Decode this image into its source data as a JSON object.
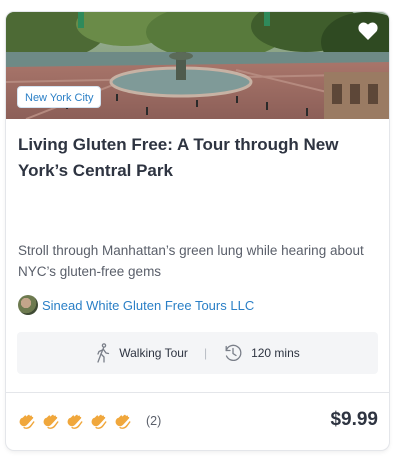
{
  "card": {
    "location": "New York City",
    "title": "Living Gluten Free: A Tour through New York’s Central Park",
    "description": "Stroll through Manhattan’s green lung while hearing about NYC’s gluten-free gems",
    "operator": "Sinead White Gluten Free Tours LLC",
    "tour_type": "Walking Tour",
    "duration": "120 mins",
    "rating": 5,
    "review_count": "(2)",
    "price": "$9.99",
    "colors": {
      "link": "#2a7fc6",
      "clap": "#f0a73c",
      "text": "#2e3441"
    },
    "icons": [
      "heart-icon",
      "walking-icon",
      "clock-history-icon",
      "clapping-hands-icon"
    ]
  }
}
